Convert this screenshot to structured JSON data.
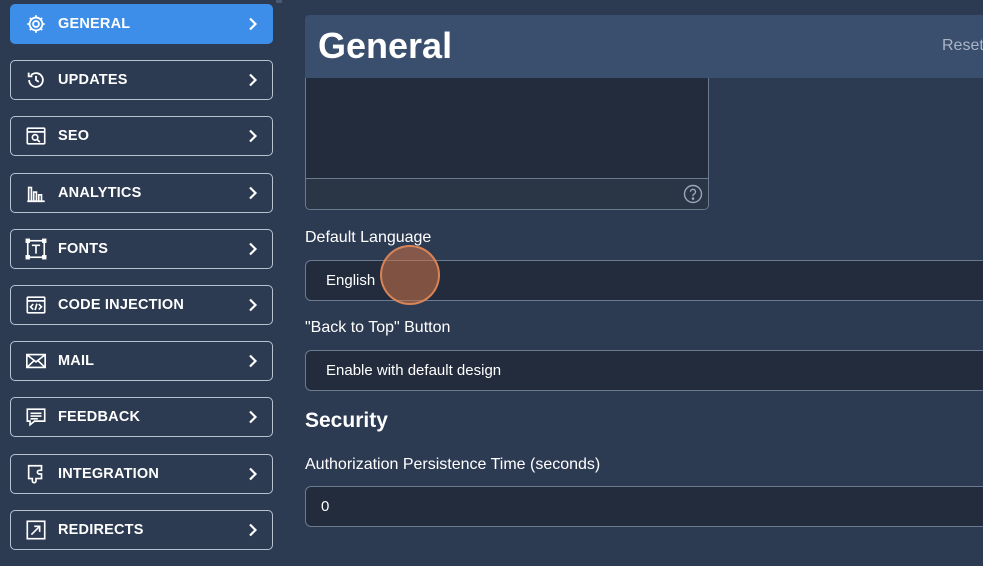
{
  "sidebar": {
    "items": [
      {
        "label": "GENERAL",
        "icon": "gear-icon",
        "active": true
      },
      {
        "label": "UPDATES",
        "icon": "history-icon",
        "active": false
      },
      {
        "label": "SEO",
        "icon": "seo-window-icon",
        "active": false
      },
      {
        "label": "ANALYTICS",
        "icon": "bar-chart-icon",
        "active": false
      },
      {
        "label": "FONTS",
        "icon": "text-frame-icon",
        "active": false
      },
      {
        "label": "CODE INJECTION",
        "icon": "code-window-icon",
        "active": false
      },
      {
        "label": "MAIL",
        "icon": "envelope-icon",
        "active": false
      },
      {
        "label": "FEEDBACK",
        "icon": "chat-bubble-icon",
        "active": false
      },
      {
        "label": "INTEGRATION",
        "icon": "puzzle-icon",
        "active": false
      },
      {
        "label": "REDIRECTS",
        "icon": "redirect-arrow-icon",
        "active": false
      }
    ],
    "active_color": "#3d8ee8"
  },
  "header": {
    "title": "General",
    "reset_label": "Reset"
  },
  "form": {
    "default_language": {
      "label": "Default Language",
      "value": "English"
    },
    "back_to_top": {
      "label": "\"Back to Top\" Button",
      "value": "Enable with default design"
    },
    "security": {
      "heading": "Security",
      "auth_time": {
        "label": "Authorization Persistence Time (seconds)",
        "value": "0"
      }
    }
  },
  "colors": {
    "background": "#2c3a52",
    "header": "#3a4e6e",
    "field": "#222c3c",
    "cursor": "#cd7346"
  }
}
